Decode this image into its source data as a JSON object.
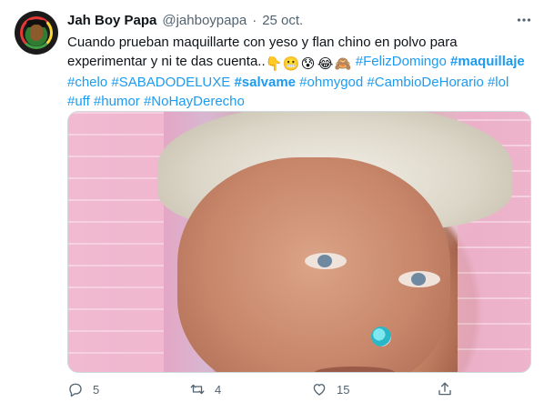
{
  "tweet": {
    "author_name": "Jah Boy Papa",
    "author_handle": "@jahboypapa",
    "separator": "·",
    "date": "25 oct.",
    "more_icon": "more-horizontal-icon",
    "text_line1": "Cuando prueban maquillarte con yeso y flan chino en polvo para",
    "text_line2_prefix": "experimentar y ni te das cuenta..",
    "emojis": [
      "👇",
      "😬",
      "😰",
      "😂",
      "🙈"
    ],
    "hashtags_line2": [
      "#FelizDomingo",
      "#maquillaje"
    ],
    "hashtags_line3": [
      "#chelo",
      "#SABADODELUXE",
      "#salvame",
      "#ohmygod",
      "#CambioDeHorario",
      "#lol"
    ],
    "hashtags_line4": [
      "#uff",
      "#humor",
      "#NoHayDerecho"
    ],
    "bold_hashtags": [
      "#maquillaje",
      "#salvame"
    ]
  },
  "actions": {
    "reply_count": "5",
    "retweet_count": "4",
    "like_count": "15",
    "reply_icon": "reply-icon",
    "retweet_icon": "retweet-icon",
    "like_icon": "heart-icon",
    "share_icon": "share-icon"
  },
  "colors": {
    "link": "#1d9bf0",
    "muted": "#536471",
    "text": "#0f1419"
  }
}
